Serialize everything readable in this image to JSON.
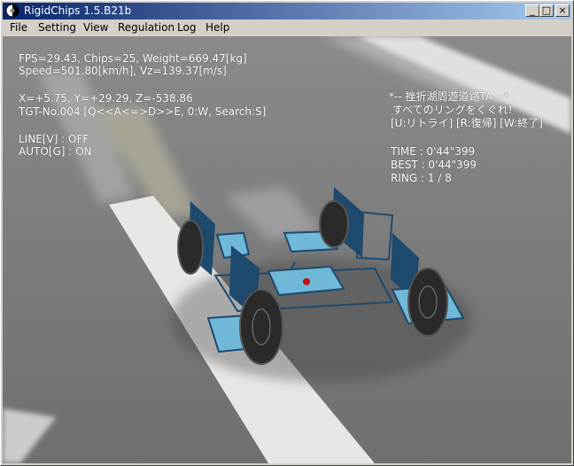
{
  "window": {
    "title": "RigidChips 1.5.B21b"
  },
  "title_buttons": {
    "minimize": "_",
    "maximize": "□",
    "close": "×"
  },
  "menu": [
    "File",
    "Setting",
    "View",
    "Regulation",
    "Log",
    "Help"
  ],
  "hud_left": {
    "line1": "FPS=29.43, Chips=25, Weight=669.47[kg]",
    "line2": "Speed=501.80[km/h], Vz=139.37[m/s]",
    "line3": "X=+5.75, Y=+29.29, Z=-538.86",
    "line4": "TGT-No.004 [Q<<A<=>D>>E, 0:W, Search:S]",
    "line5": "LINE[V] : OFF",
    "line6": "AUTO[G] : ON"
  },
  "hud_right": {
    "course_title": "*-- 挫折湖周遊道路TA --*",
    "instruction": "すべてのリングをくぐれ!",
    "keys": "[U:リトライ] [R:復帰] [W:終了]",
    "time": "TIME :   0'44\"399",
    "best": "BEST :   0'44\"399",
    "ring": "RING : 1 / 8"
  },
  "colors": {
    "title_start": "#0a246a",
    "title_end": "#a6caf0",
    "ground": "#7a7a7a",
    "chip_blue": "#1e4a6e",
    "chip_light": "#6fb8d8",
    "tire": "#2a2a2a"
  },
  "icons": {
    "app": "rigidchips-app-icon"
  }
}
